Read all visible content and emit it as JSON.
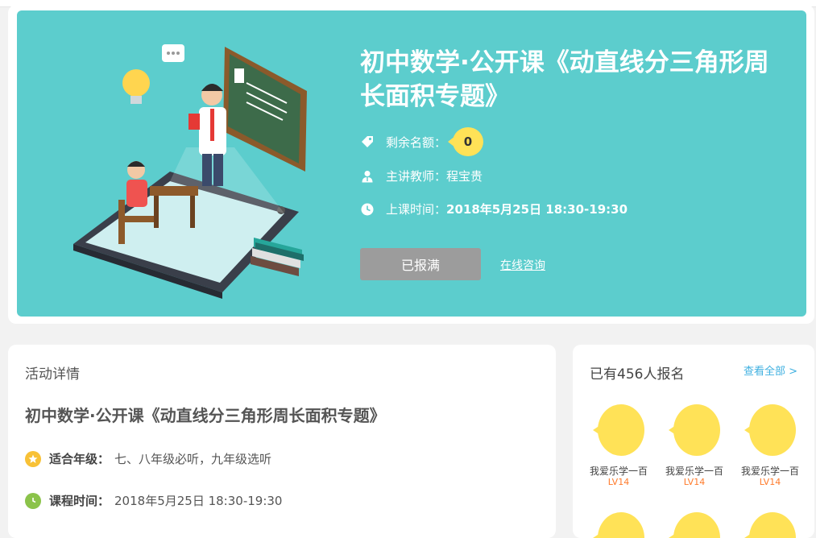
{
  "hero": {
    "title": "初中数学·公开课《动直线分三角形周长面积专题》",
    "quota_label": "剩余名额：",
    "quota_value": "0",
    "teacher_label": "主讲教师：",
    "teacher_name": "程宝贵",
    "time_label": "上课时间：",
    "time_value": "2018年5月25日 18:30-19:30",
    "full_button": "已报满",
    "consult_link": "在线咨询",
    "colors": {
      "background": "#5ccdcd",
      "badge": "#ffe257",
      "button": "#9c9c9c"
    }
  },
  "detail": {
    "heading": "活动详情",
    "title": "初中数学·公开课《动直线分三角形周长面积专题》",
    "grade_label": "适合年级：",
    "grade_value": "七、八年级必听，九年级选听",
    "time_label": "课程时间：",
    "time_value": "2018年5月25日 18:30-19:30",
    "colors": {
      "star_icon": "#f8c136",
      "clock_icon": "#8bc34a"
    }
  },
  "signups": {
    "count_text": "已有456人报名",
    "view_all": "查看全部 >",
    "users": [
      {
        "name": "我爱乐学一百",
        "level": "LV14"
      },
      {
        "name": "我爱乐学一百",
        "level": "LV14"
      },
      {
        "name": "我爱乐学一百",
        "level": "LV14"
      }
    ],
    "colors": {
      "avatar": "#ffe257",
      "level": "#ff7a2a",
      "link": "#3fb0e0"
    }
  }
}
